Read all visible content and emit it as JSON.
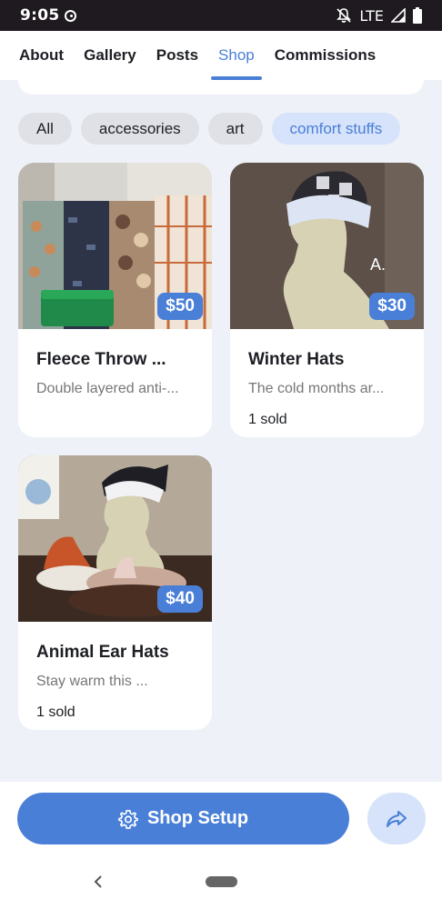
{
  "status_bar": {
    "time": "9:05",
    "network": "LTE"
  },
  "tabs": [
    {
      "label": "About"
    },
    {
      "label": "Gallery"
    },
    {
      "label": "Posts"
    },
    {
      "label": "Shop",
      "active": true
    },
    {
      "label": "Commissions"
    }
  ],
  "chips": [
    {
      "label": "All"
    },
    {
      "label": "accessories"
    },
    {
      "label": "art"
    },
    {
      "label": "comfort stuffs",
      "active": true
    }
  ],
  "products": [
    {
      "title": "Fleece Throw ...",
      "description": "Double layered anti-...",
      "price": "$50",
      "sold": ""
    },
    {
      "title": "Winter Hats",
      "description": "The cold months ar...",
      "price": "$30",
      "sold": "1 sold",
      "image_text": "A."
    },
    {
      "title": "Animal Ear Hats",
      "description": "Stay warm this ...",
      "price": "$40",
      "sold": "1 sold"
    }
  ],
  "bottom": {
    "setup_label": "Shop Setup"
  },
  "colors": {
    "accent": "#4a7fd8",
    "accent_light": "#d6e3fa",
    "chip_bg": "#dfe1e6",
    "page_bg": "#eef1f7"
  }
}
